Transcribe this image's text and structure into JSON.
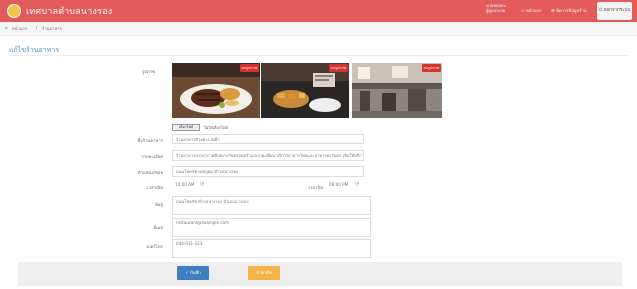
{
  "header": {
    "app_title": "เทศบาลตำบลนางรอง",
    "user_line1": "นายทดสอบ",
    "user_line2": "ผู้ดูแลระบบ",
    "nav_home": "หน้าแรก",
    "nav_manage": "จัดการข้อมูลร้าน",
    "logout": "ออกจากระบบ"
  },
  "breadcrumb": {
    "home": "หน้าแรก",
    "current": "ร้านอาหาร"
  },
  "page": {
    "title": "แก้ไขร้านอาหาร"
  },
  "form": {
    "images_label": "รูปภาพ",
    "image_tag": "ลบรูปภาพ",
    "file_button": "เลือกไฟล์",
    "file_status": "ไม่ได้เลือกไฟล์",
    "name_label": "ชื่อร้านอาหาร",
    "name_value": "ร้านอาหารตัวอย่าง สเต็ก",
    "detail_label": "รายละเอียด",
    "detail_value": "ร้านอาหารบรรยากาศดีเหมาะกับครอบครัวและกลุ่มเพื่อน บริการอาหารไทยและอาหารตะวันตก เปิดให้บริการทุกวัน",
    "address_label": "ตำแหน่ง/ซอย",
    "address_value": "ถนนโชคชัย-เดชอุดม ตำบลนางรอง",
    "open_label": "เวลาเปิด",
    "open_value": "10:00 AM",
    "close_label": "เวลาปิด",
    "close_value": "08:00 PM",
    "location_label": "ที่อยู่",
    "location_value": "ถนนโชคชัย ตำบลนางรอง อำเภอนางรอง",
    "contact_label": "อีเมล",
    "contact_value": "restaurant@example.com",
    "phone_label": "เบอร์โทร",
    "phone_value": "044-631-123"
  },
  "footer": {
    "save": "บันทึก",
    "cancel": "ยกเลิก"
  },
  "colors": {
    "header": "#e25a5a",
    "title": "#4a8fc9",
    "save": "#3d7fc1",
    "cancel": "#f3b54a",
    "tag": "#d9322e"
  }
}
